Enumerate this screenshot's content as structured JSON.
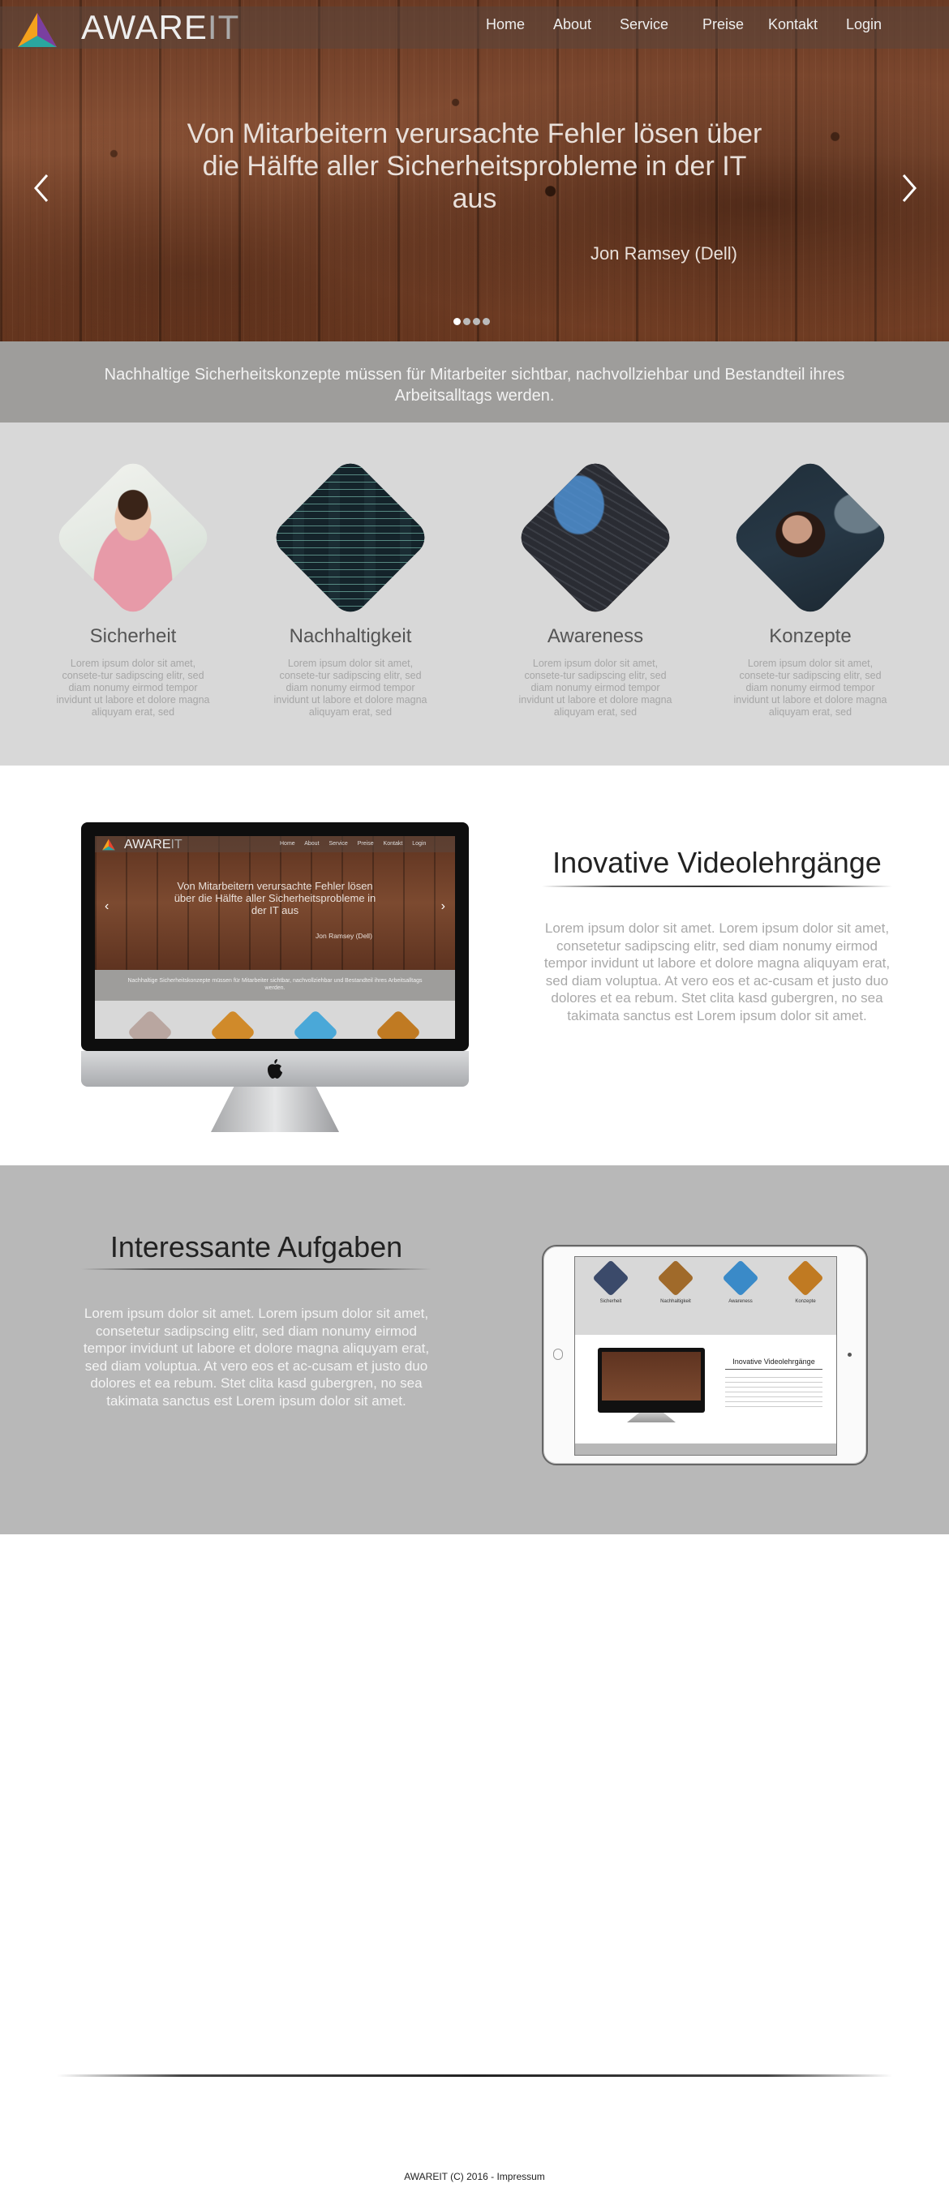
{
  "brand": {
    "name_main": "AWARE",
    "name_suffix": "IT"
  },
  "nav": [
    {
      "label": "Home"
    },
    {
      "label": "About"
    },
    {
      "label": "Service"
    },
    {
      "label": "Preise"
    },
    {
      "label": "Kontakt"
    },
    {
      "label": "Login"
    }
  ],
  "hero": {
    "quote": "Von Mitarbeitern verursachte Fehler lösen über die Hälfte aller Sicherheitsprobleme in der IT aus",
    "author": "Jon Ramsey (Dell)",
    "slide_count": 4,
    "active_slide": 1
  },
  "tagline": "Nachhaltige Sicherheitskonzepte müssen für Mitarbeiter sichtbar, nachvollziehbar und Bestandteil ihres Arbeitsalltags werden.",
  "features": [
    {
      "title": "Sicherheit",
      "text": "Lorem ipsum dolor sit amet, consete-tur sadipscing elitr, sed diam nonumy eirmod tempor invidunt ut labore et dolore magna aliquyam erat, sed",
      "icon": "woman-laptop-photo"
    },
    {
      "title": "Nachhaltigkeit",
      "text": "Lorem ipsum dolor sit amet, consete-tur sadipscing elitr, sed diam nonumy eirmod tempor invidunt ut labore et dolore magna aliquyam erat, sed",
      "icon": "code-screen-photo"
    },
    {
      "title": "Awareness",
      "text": "Lorem ipsum dolor sit amet, consete-tur sadipscing elitr, sed diam nonumy eirmod tempor invidunt ut labore et dolore magna aliquyam erat, sed",
      "icon": "keyboard-photo"
    },
    {
      "title": "Konzepte",
      "text": "Lorem ipsum dolor sit amet, consete-tur sadipscing elitr, sed diam nonumy eirmod tempor invidunt ut labore et dolore magna aliquyam erat, sed",
      "icon": "woman-monitor-photo"
    }
  ],
  "video_section": {
    "title": "Inovative Videolehrgänge",
    "text": "Lorem ipsum dolor sit amet. Lorem ipsum dolor sit amet, consetetur sadipscing elitr, sed diam nonumy eirmod tempor invidunt ut labore et dolore magna aliquyam erat, sed diam voluptua. At vero eos et ac-cusam et justo duo dolores et ea rebum. Stet clita kasd gubergren, no sea takimata sanctus est Lorem ipsum dolor sit amet."
  },
  "tasks_section": {
    "title": "Interessante Aufgaben",
    "text": "Lorem ipsum dolor sit amet. Lorem ipsum dolor sit amet, consetetur sadipscing elitr, sed diam nonumy eirmod tempor invidunt ut labore et dolore magna aliquyam erat, sed diam voluptua. At vero eos et ac-cusam et justo duo dolores et ea rebum. Stet clita kasd gubergren, no sea takimata sanctus est Lorem ipsum dolor sit amet."
  },
  "mockup": {
    "quote": "Von Mitarbeitern verursachte Fehler lösen über die Hälfte aller Sicherheitsprobleme in der IT aus",
    "author": "Jon Ramsey (Dell)",
    "tagline": "Nachhaltige Sicherheitskonzepte müssen für Mitarbeiter sichtbar, nachvollziehbar und Bestandteil ihres Arbeitsalltags werden.",
    "feature_titles": [
      "Sicherheit",
      "Nachhaltigkeit",
      "Awareness",
      "Konzepte"
    ],
    "video_title": "Inovative Videolehrgänge"
  },
  "footer": "AWAREIT (C) 2016 - Impressum"
}
